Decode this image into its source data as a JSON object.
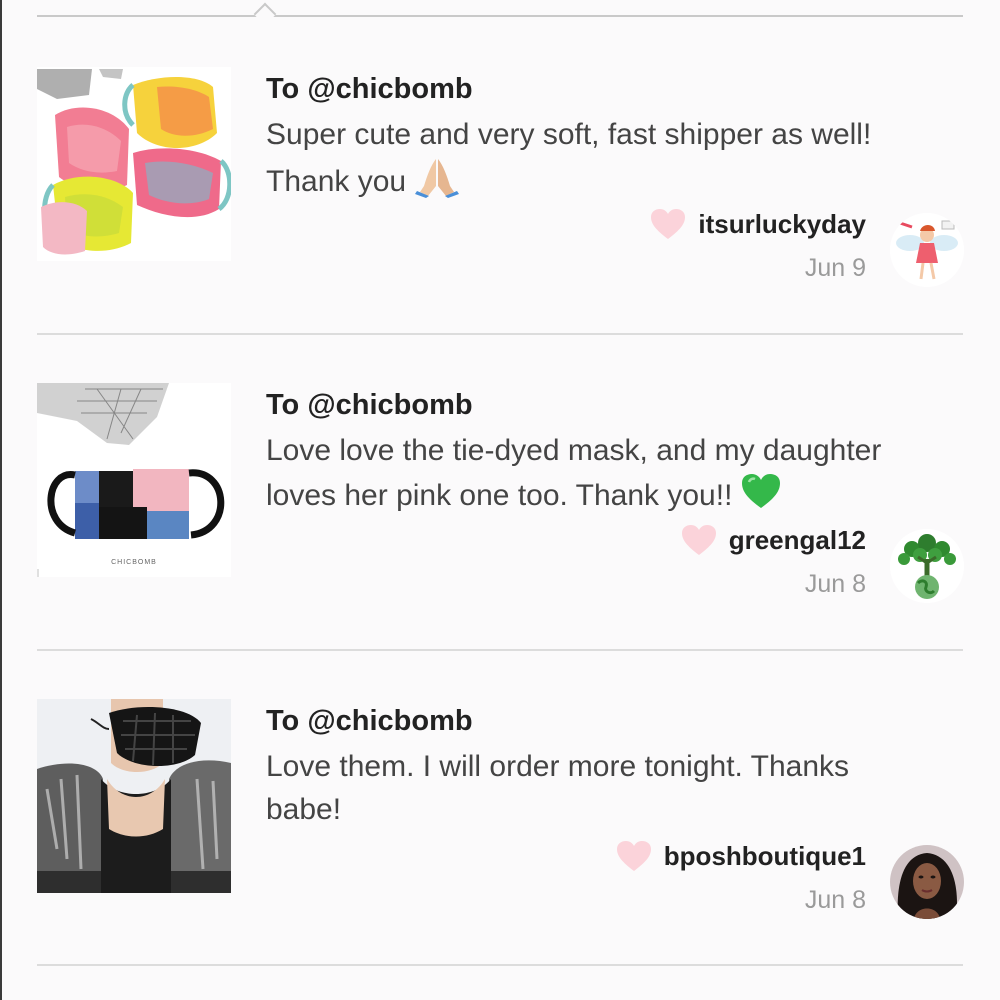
{
  "reviews": [
    {
      "recipient": "To @chicbomb",
      "message_line1": "Super cute and very soft, fast shipper as well!",
      "message_line2": "Thank you",
      "emoji": "folded-hands-icon",
      "username": "itsurluckyday",
      "date": "Jun 9",
      "product_image": "tie-dye-masks-photo",
      "avatar_image": "fairy-avatar"
    },
    {
      "recipient": "To @chicbomb",
      "message_line1": "Love love the tie-dyed mask, and my daughter",
      "message_line2": "loves her pink one too. Thank you!!",
      "emoji": "green-heart-icon",
      "username": "greengal12",
      "date": "Jun 8",
      "product_image": "patchwork-mask-photo",
      "product_image_caption": "CHICBOMB",
      "avatar_image": "tree-globe-avatar"
    },
    {
      "recipient": "To @chicbomb",
      "message_line1": "Love them. I will order more tonight. Thanks",
      "message_line2": "babe!",
      "username": "bposhboutique1",
      "date": "Jun 8",
      "product_image": "black-mask-model-photo",
      "avatar_image": "woman-selfie-avatar"
    }
  ],
  "colors": {
    "heart": "#fbd3da",
    "divider": "#dcdcdc",
    "date": "#9a9a9a",
    "background": "#fbfafb"
  }
}
